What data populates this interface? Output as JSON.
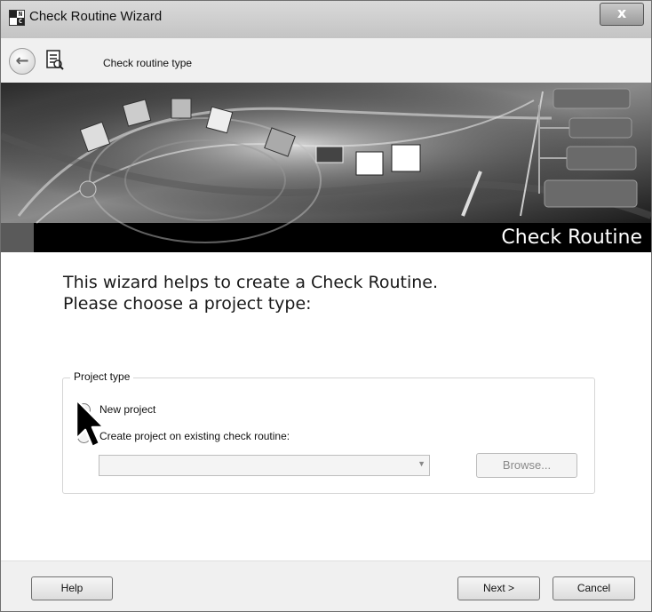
{
  "window": {
    "title": "Check Routine Wizard",
    "app_icon_letters": [
      "",
      "N",
      "",
      "C"
    ],
    "close_glyph": "x"
  },
  "nav": {
    "back_glyph": "←",
    "step_title": "Check routine type"
  },
  "banner": {
    "caption": "Check Routine"
  },
  "intro": {
    "line1": "This wizard helps to create a Check Routine.",
    "line2": "Please choose a project type:"
  },
  "project_type": {
    "legend": "Project type",
    "options": [
      {
        "label": "New project",
        "selected": true
      },
      {
        "label": "Create project on existing check routine:",
        "selected": false
      }
    ],
    "existing_value": "",
    "browse_label": "Browse..."
  },
  "footer": {
    "help_label": "Help",
    "next_label": "Next >",
    "cancel_label": "Cancel"
  },
  "colors": {
    "banner_background": "#000000",
    "content_background": "#ffffff",
    "chrome": "#f0f0f0"
  }
}
